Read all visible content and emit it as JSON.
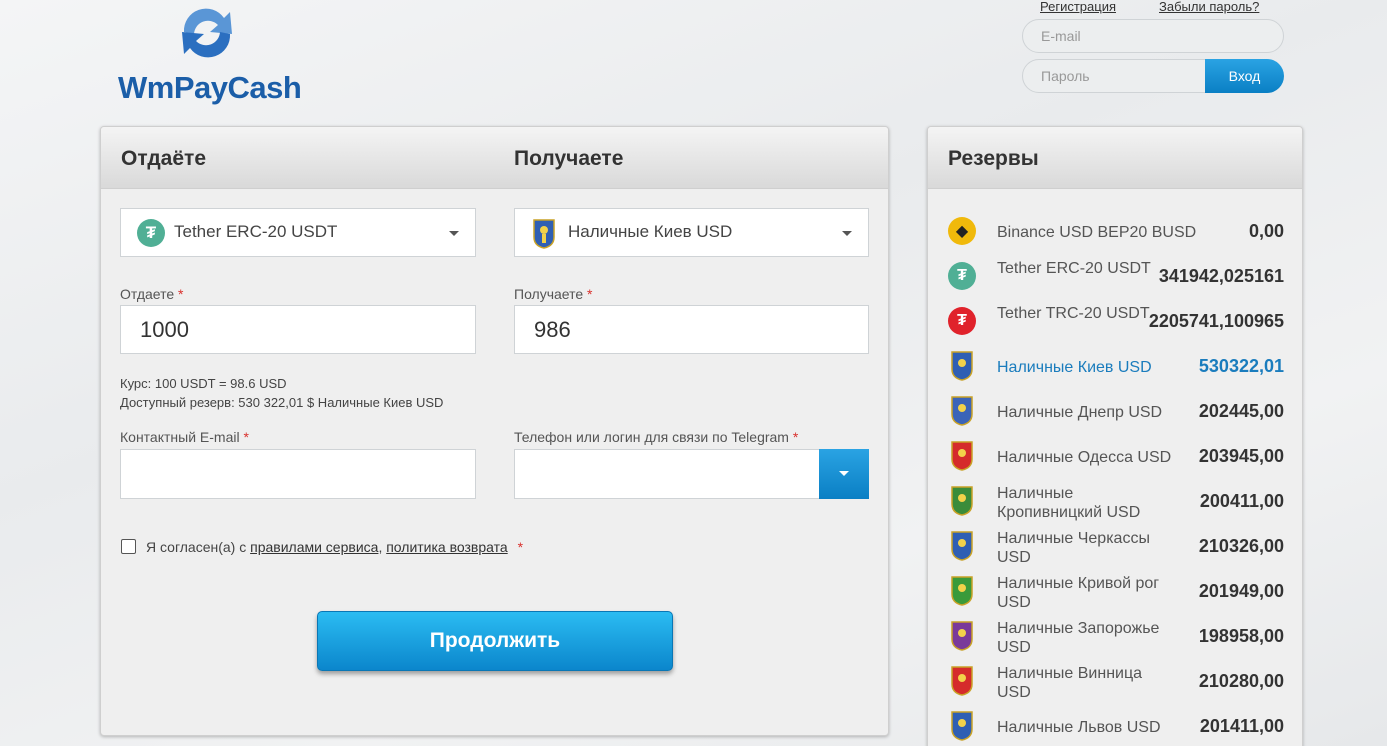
{
  "brand": {
    "logo_text": "WmPayCash"
  },
  "auth": {
    "register_label": "Регистрация",
    "forgot_label": "Забыли пароль?",
    "email_placeholder": "E-mail",
    "password_placeholder": "Пароль",
    "login_label": "Вход"
  },
  "exchange": {
    "give_title": "Отдаёте",
    "get_title": "Получаете",
    "give_currency": "Tether ERC-20 USDT",
    "get_currency": "Наличные Киев USD",
    "give_amount_label": "Отдаете",
    "get_amount_label": "Получаете",
    "give_amount": "1000",
    "get_amount": "986",
    "rate_text": "Курс: 100 USDT = 98.6 USD",
    "reserve_text": "Доступный резерв: 530 322,01 $ Наличные Киев USD",
    "email_label": "Контактный E-mail",
    "telegram_label": "Телефон или логин для связи по Telegram",
    "required_mark": "*",
    "agree_prefix": "Я согласен(а) с",
    "rules_link": "правилами сервиса",
    "separator": ",",
    "refund_link": "политика возврата",
    "continue_label": "Продолжить"
  },
  "reserves": {
    "title": "Резервы",
    "items": [
      {
        "name": "Binance USD BEP20 BUSD",
        "amount": "0,00",
        "icon": "binance-icon",
        "color": "#f0b90b"
      },
      {
        "name": "Tether ERC-20 USDT",
        "amount": "341942,025161",
        "icon": "tether-icon",
        "color": "#50af95"
      },
      {
        "name": "Tether TRC-20 USDT",
        "amount": "2205741,100965",
        "icon": "tether-trc-icon",
        "color": "#e0222b"
      },
      {
        "name": "Наличные Киев USD",
        "amount": "530322,01",
        "icon": "kyiv-coat-icon",
        "color": "#2f5fb3"
      },
      {
        "name": "Наличные Днепр USD",
        "amount": "202445,00",
        "icon": "dnipro-coat-icon",
        "color": "#3b64b8"
      },
      {
        "name": "Наличные Одесса USD",
        "amount": "203945,00",
        "icon": "odesa-coat-icon",
        "color": "#d52b2b"
      },
      {
        "name": "Наличные Кропивницкий USD",
        "amount": "200411,00",
        "icon": "kropyvnytskyi-coat-icon",
        "color": "#3a8c3a"
      },
      {
        "name": "Наличные Черкассы USD",
        "amount": "210326,00",
        "icon": "cherkasy-coat-icon",
        "color": "#2f5fb3"
      },
      {
        "name": "Наличные Кривой рог USD",
        "amount": "201949,00",
        "icon": "kryvyi-rih-coat-icon",
        "color": "#3a9a3a"
      },
      {
        "name": "Наличные Запорожье USD",
        "amount": "198958,00",
        "icon": "zaporizhzhia-coat-icon",
        "color": "#7a3a9a"
      },
      {
        "name": "Наличные Винница USD",
        "amount": "210280,00",
        "icon": "vinnytsia-coat-icon",
        "color": "#d52b2b"
      },
      {
        "name": "Наличные Львов USD",
        "amount": "201411,00",
        "icon": "lviv-coat-icon",
        "color": "#2f5fb3"
      }
    ]
  }
}
